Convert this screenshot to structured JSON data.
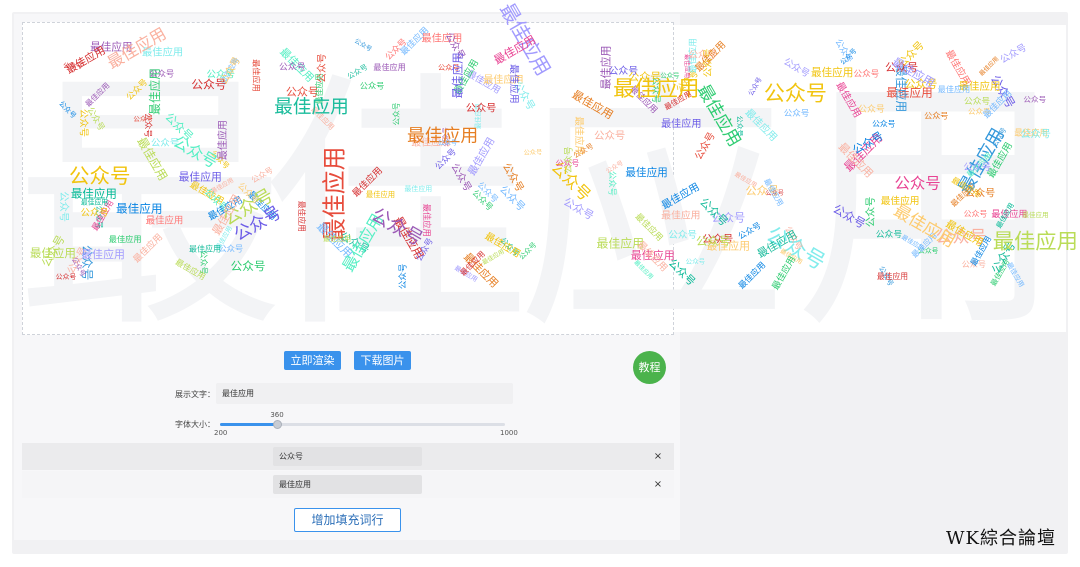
{
  "canvas": {
    "word": "最佳应用",
    "glyphs": [
      "最",
      "佳",
      "应",
      "用"
    ],
    "ghost_color": "#f3f4f6",
    "fill_words": [
      "公众号",
      "最佳应用"
    ],
    "palette": [
      "#e74c3c",
      "#9b59b6",
      "#3498db",
      "#2ecc71",
      "#f1c40f",
      "#e67e22",
      "#1abc9c",
      "#e84393",
      "#6c5ce7",
      "#00b894",
      "#fdcb6e",
      "#0984e3",
      "#d63031",
      "#a29bfe",
      "#55efc4",
      "#ff7675",
      "#74b9ff",
      "#fab1a0",
      "#81ecec",
      "#badc58"
    ]
  },
  "toolbar": {
    "render_label": "立即渲染",
    "download_label": "下载图片",
    "tutorial_label": "教程"
  },
  "settings": {
    "text_label": "展示文字：",
    "text_value": "最佳应用",
    "size_label": "字体大小：",
    "size_min": "200",
    "size_max": "1000",
    "size_value": "360",
    "size_fraction": 0.2
  },
  "fill_rows": [
    {
      "word": "公众号",
      "remove": "×"
    },
    {
      "word": "最佳应用",
      "remove": "×"
    }
  ],
  "add_row_label": "增加填充词行",
  "watermark": "WK綜合論壇"
}
